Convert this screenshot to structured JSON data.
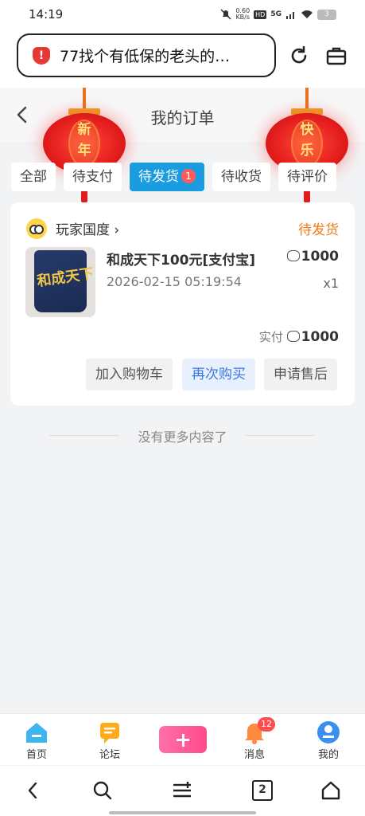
{
  "status_bar": {
    "time": "14:19",
    "network_speed_value": "0.60",
    "network_speed_unit": "KB/s",
    "hd_label": "HD",
    "network_type": "5G",
    "battery": "3"
  },
  "browser": {
    "url": "77找个有低保的老头的…"
  },
  "header": {
    "title": "我的订单"
  },
  "lanterns": {
    "left": [
      "新",
      "年"
    ],
    "right": [
      "快",
      "乐"
    ]
  },
  "tabs": [
    {
      "label": "全部",
      "active": false
    },
    {
      "label": "待支付",
      "active": false
    },
    {
      "label": "待发货",
      "active": true,
      "badge": "1"
    },
    {
      "label": "待收货",
      "active": false
    },
    {
      "label": "待评价",
      "active": false
    }
  ],
  "order": {
    "shop_name": "玩家国度",
    "status": "待发货",
    "product_name": "和成天下100元[支付宝]",
    "price": "1000",
    "time": "2026-02-15 05:19:54",
    "quantity": "x1",
    "paid_label": "实付",
    "paid_amount": "1000",
    "product_image_text": "和成天下",
    "buttons": {
      "add_cart": "加入购物车",
      "buy_again": "再次购买",
      "after_sale": "申请售后"
    }
  },
  "no_more": "没有更多内容了",
  "bottom_nav": [
    {
      "label": "首页"
    },
    {
      "label": "论坛"
    },
    {
      "label": ""
    },
    {
      "label": "消息",
      "badge": "12"
    },
    {
      "label": "我的"
    }
  ],
  "system_nav": {
    "tabs_count": "2"
  },
  "colors": {
    "accent": "#1b9be0",
    "status_orange": "#f07b16",
    "badge_red": "#ff5a5a",
    "post_pink": "#ff5c96"
  }
}
